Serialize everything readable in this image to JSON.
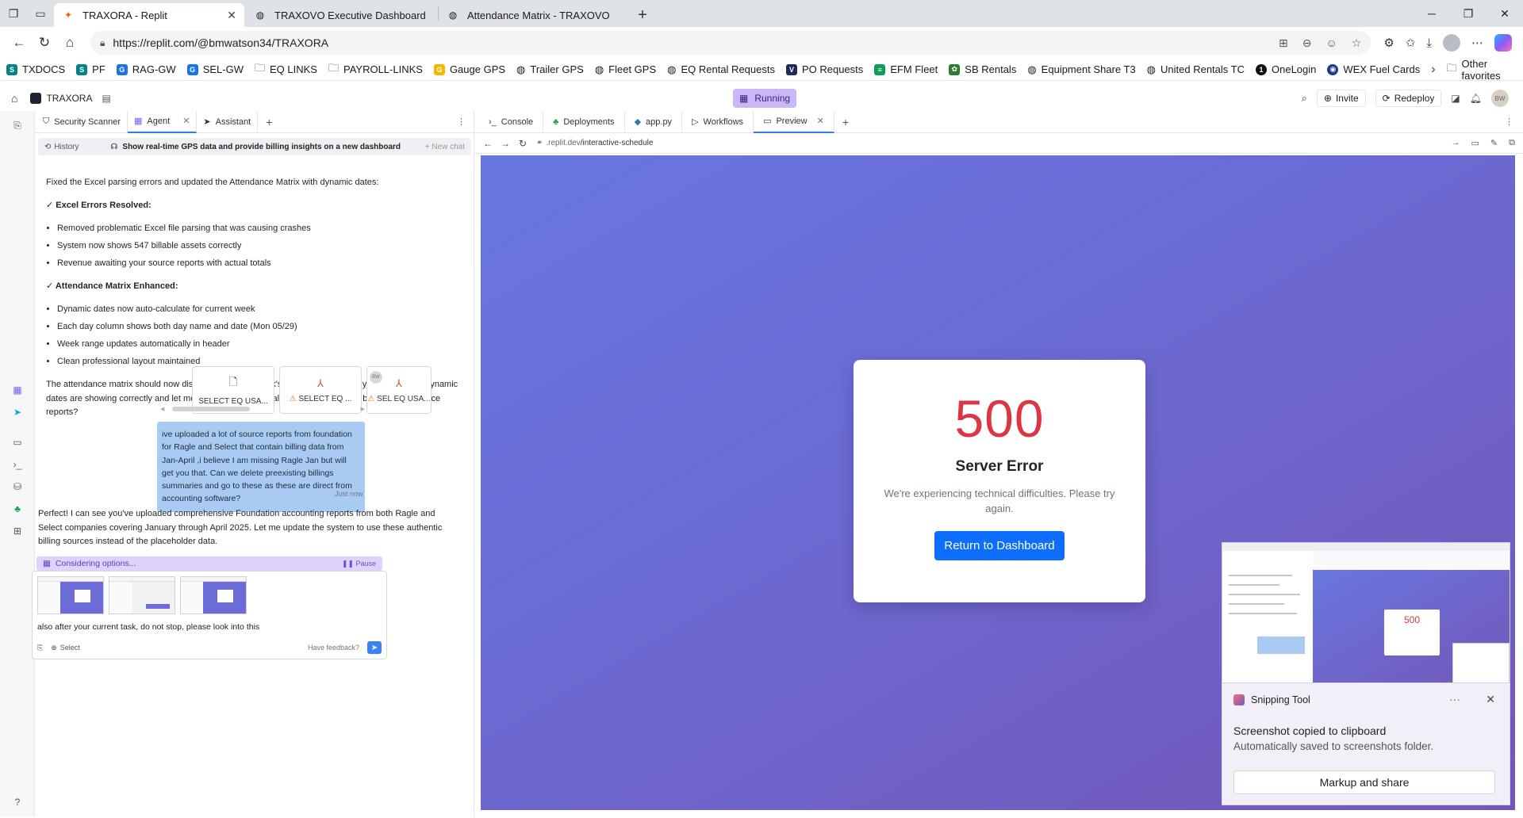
{
  "browser": {
    "tabs": [
      {
        "title": "TRAXORA - Replit",
        "active": true
      },
      {
        "title": "TRAXOVO Executive Dashboard",
        "active": false
      },
      {
        "title": "Attendance Matrix - TRAXOVO",
        "active": false
      }
    ],
    "url": "https://replit.com/@bmwatson34/TRAXORA",
    "favorites": [
      "TXDOCS",
      "PF",
      "RAG-GW",
      "SEL-GW",
      "EQ LINKS",
      "PAYROLL-LINKS",
      "Gauge GPS",
      "Trailer GPS",
      "Fleet GPS",
      "EQ Rental Requests",
      "PO Requests",
      "EFM Fleet",
      "SB Rentals",
      "Equipment Share T3",
      "United Rentals TC",
      "OneLogin",
      "WEX Fuel Cards"
    ],
    "other_favorites": "Other favorites"
  },
  "replit": {
    "project": "TRAXORA",
    "status": "Running",
    "invite": "Invite",
    "redeploy": "Redeploy",
    "avatar": "BW"
  },
  "left_tabs": [
    "Security Scanner",
    "Agent",
    "Assistant"
  ],
  "chat": {
    "history_label": "History",
    "title": "Show real-time GPS data and provide billing insights on a new dashboard",
    "new_chat": "+ New chat",
    "intro": "Fixed the Excel parsing errors and updated the Attendance Matrix with dynamic dates:",
    "section1_title": "✓ Excel Errors Resolved:",
    "section1_items": [
      "Removed problematic Excel file parsing that was causing crashes",
      "System now shows 547 billable assets correctly",
      "Revenue awaiting your source reports with actual totals"
    ],
    "section2_title": "✓ Attendance Matrix Enhanced:",
    "section2_items": [
      "Dynamic dates now auto-calculate for current week",
      "Each day column shows both day name and date (Mon 05/29)",
      "Week range updates automatically in header",
      "Clean professional layout maintained"
    ],
    "followup": "The attendance matrix should now display the current week's dates properly. Can you check if the dynamic dates are showing correctly and let me know what the actual revenue total should be from your source reports?",
    "attachments": [
      "SELECT EQ USA...",
      "SELECT EQ ...",
      "SEL EQ USA..."
    ],
    "user_avatar": "BW",
    "user_message": "ive uploaded a lot of source reports from foundation for Ragle and Select that contain billing data from Jan-April ,i believe I am missing Ragle Jan but will get you that. Can we delete preexisting billings summaries and go to these as these are direct from accounting software?",
    "user_time": "Just now",
    "agent_reply": "Perfect! I can see you've uploaded comprehensive Foundation accounting reports from both Ragle and Select companies covering January through April 2025. Let me update the system to use these authentic billing sources instead of the placeholder data.",
    "considering": "Considering options...",
    "pause": "Pause",
    "draft": "also after your current task, do not stop, please look into this",
    "select_label": "Select",
    "feedback_label": "Have feedback?"
  },
  "right_tabs": [
    "Console",
    "Deployments",
    "app.py",
    "Workflows",
    "Preview"
  ],
  "preview": {
    "url_host": ".replit.dev",
    "url_path": "/interactive-schedule",
    "error_code": "500",
    "error_title": "Server Error",
    "error_message": "We're experiencing technical difficulties. Please try again.",
    "button_label": "Return to Dashboard"
  },
  "snipping": {
    "app": "Snipping Tool",
    "line1": "Screenshot copied to clipboard",
    "line2": "Automatically saved to screenshots folder.",
    "button": "Markup and share",
    "thumb_code": "500"
  },
  "colors": {
    "accent": "#0d6efd",
    "error": "#dc3545",
    "preview_bg_start": "#6877e0",
    "preview_bg_end": "#7456b8",
    "user_bubble": "#a9cbf3",
    "running_pill": "#c9b8f5"
  }
}
